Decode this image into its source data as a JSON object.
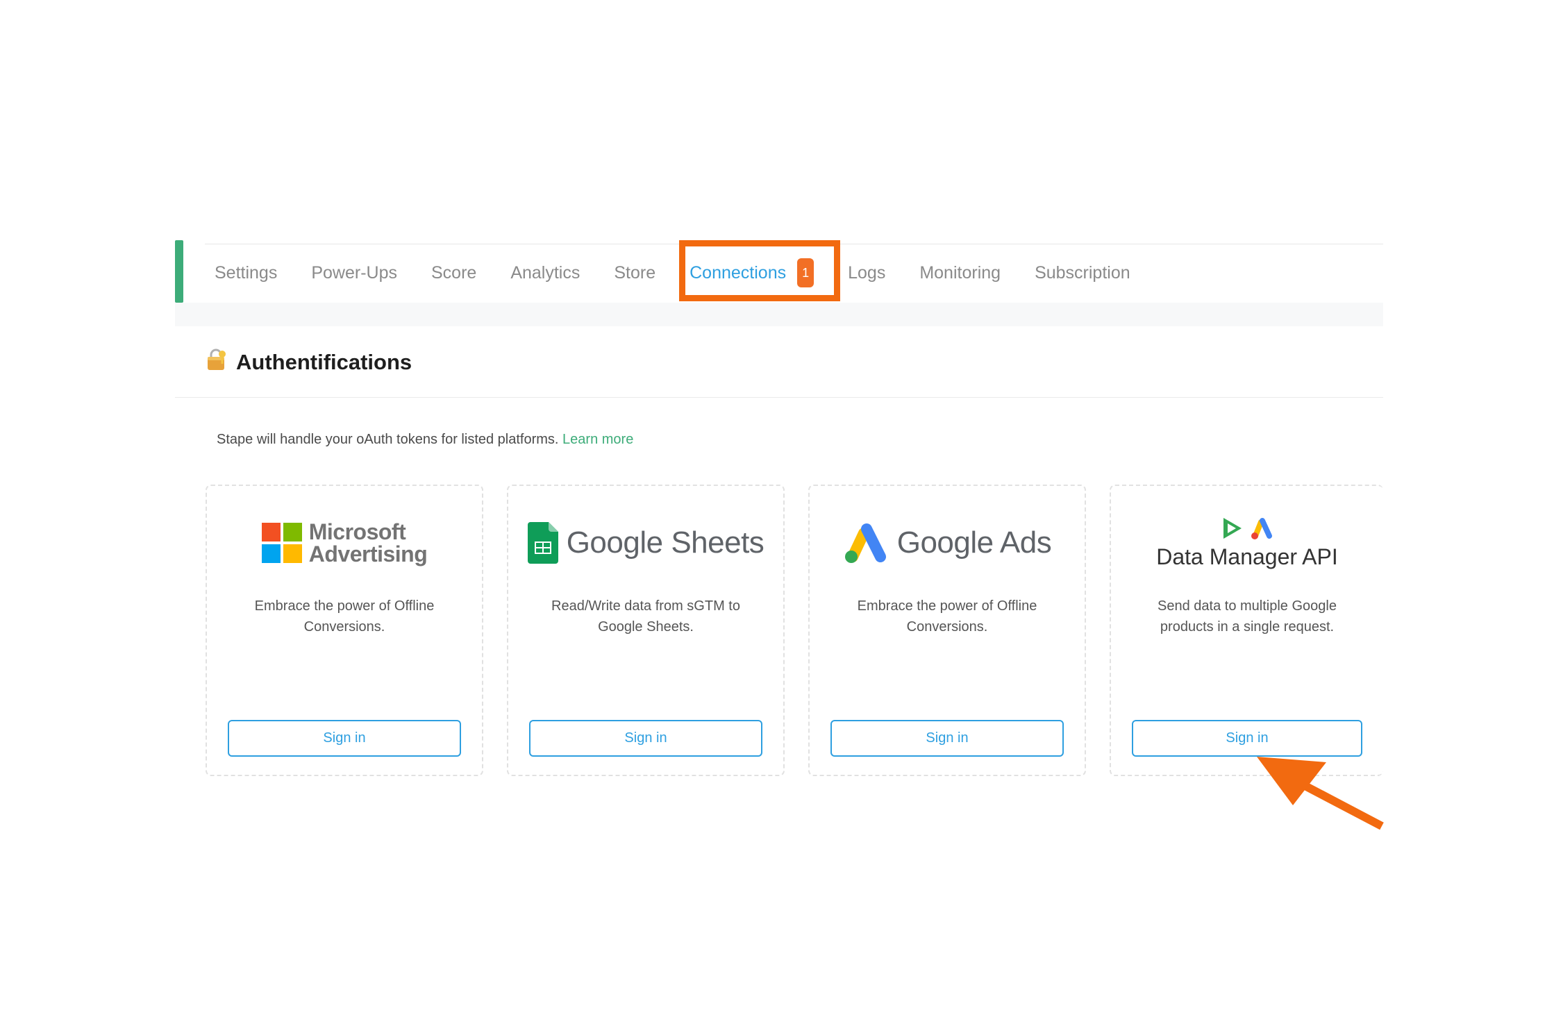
{
  "tabs": [
    {
      "label": "Settings"
    },
    {
      "label": "Power-Ups"
    },
    {
      "label": "Score"
    },
    {
      "label": "Analytics"
    },
    {
      "label": "Store"
    },
    {
      "label": "Connections",
      "badge": "1",
      "active": true
    },
    {
      "label": "Logs"
    },
    {
      "label": "Monitoring"
    },
    {
      "label": "Subscription"
    }
  ],
  "section": {
    "title": "Authentifications",
    "icon": "lock-key-icon"
  },
  "intro": {
    "text": "Stape will handle your oAuth tokens for listed platforms.",
    "link": "Learn more"
  },
  "cards": [
    {
      "logo_line1": "Microsoft",
      "logo_line2": "Advertising",
      "description": "Embrace the power of Offline Conversions.",
      "button": "Sign in"
    },
    {
      "logo_prefix": "Google",
      "logo_suffix": "Sheets",
      "description": "Read/Write data from sGTM to Google Sheets.",
      "button": "Sign in"
    },
    {
      "logo_prefix": "Google",
      "logo_suffix": "Ads",
      "description": "Embrace the power of Offline Conversions.",
      "button": "Sign in"
    },
    {
      "logo_title": "Data Manager API",
      "description": "Send data to multiple Google products in a single request.",
      "button": "Sign in"
    }
  ],
  "colors": {
    "accent": "#2e9fe0",
    "highlight": "#f26a10",
    "green": "#3dac79",
    "badge": "#f26f25"
  }
}
